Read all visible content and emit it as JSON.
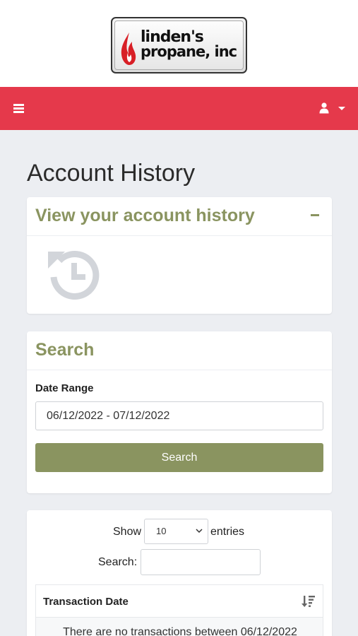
{
  "brand": {
    "logo_line1": "linden's",
    "logo_line2": "propane, inc"
  },
  "navbar": {
    "color": "#e5394b",
    "menu_icon": "hamburger-menu-icon",
    "user_icon": "user-icon",
    "dropdown_icon": "caret-down-icon"
  },
  "page": {
    "title": "Account History"
  },
  "history_card": {
    "title": "View your account history",
    "collapse_icon": "minus-icon",
    "illustration_icon": "history-icon"
  },
  "search_card": {
    "title": "Search",
    "date_range_label": "Date Range",
    "date_range_value": "06/12/2022 - 07/12/2022",
    "search_button": "Search"
  },
  "table_controls": {
    "show_label": "Show",
    "entries_value": "10",
    "entries_label": "entries",
    "search_label": "Search:",
    "search_value": ""
  },
  "table": {
    "columns": [
      "Transaction Date"
    ],
    "sort_icon": "sort-icon",
    "empty_message": "There are no transactions between 06/12/2022"
  },
  "colors": {
    "accent": "#8a9460",
    "page_background": "#eceef2"
  }
}
